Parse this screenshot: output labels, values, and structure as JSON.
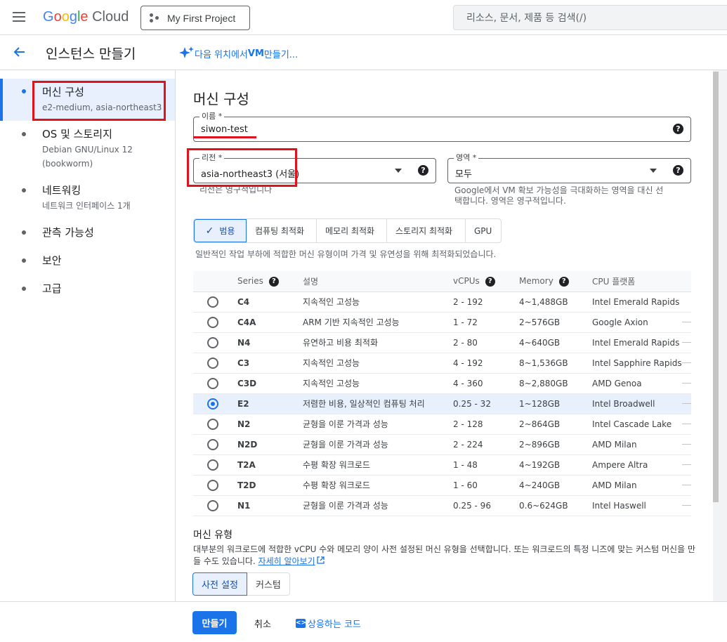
{
  "topbar": {
    "logo_google": "Google",
    "logo_cloud": "Cloud",
    "project": "My First Project",
    "search_placeholder": "리소스, 문서, 제품 등 검색(/)"
  },
  "subheader": {
    "title": "인스턴스 만들기",
    "ai_link_prefix": "다음 위치에서 ",
    "ai_link_bold": "VM",
    "ai_link_suffix": " 만들기..."
  },
  "nav": {
    "items": [
      {
        "label": "머신 구성",
        "sub": "e2-medium, asia-northeast3"
      },
      {
        "label": "OS 및 스토리지",
        "sub": "Debian GNU/Linux 12",
        "sub2": "(bookworm)"
      },
      {
        "label": "네트워킹",
        "sub": "네트워크 인터페이스 1개"
      },
      {
        "label": "관측 가능성"
      },
      {
        "label": "보안"
      },
      {
        "label": "고급"
      }
    ]
  },
  "main": {
    "section_title": "머신 구성",
    "name_label": "이름 *",
    "name_value": "siwon-test",
    "region_label": "리전 *",
    "region_value": "asia-northeast3 (서울)",
    "region_hint": "리전은 영구적입니다",
    "zone_label": "영역 *",
    "zone_value": "모두",
    "zone_hint_1": "Google에서 VM 확보 가능성을 극대화하는 영역을 대신 선",
    "zone_hint_2": "택합니다. 영역은 영구적입니다.",
    "tabs": [
      "범용",
      "컴퓨팅 최적화",
      "메모리 최적화",
      "스토리지 최적화",
      "GPU"
    ],
    "tab_desc": "일반적인 작업 부하에 적합한 머신 유형이며 가격 및 유연성을 위해 최적화되었습니다.",
    "columns": [
      "Series",
      "설명",
      "vCPUs",
      "Memory",
      "CPU 플랫폼"
    ],
    "rows": [
      {
        "series": "C4",
        "desc": "지속적인 고성능",
        "vcpus": "2 - 192",
        "memory": "4~1,488GB",
        "cpu": "Intel Emerald Rapids"
      },
      {
        "series": "C4A",
        "desc": "ARM 기반 지속적인 고성능",
        "vcpus": "1 - 72",
        "memory": "2~576GB",
        "cpu": "Google Axion"
      },
      {
        "series": "N4",
        "desc": "유연하고 비용 최적화",
        "vcpus": "2 - 80",
        "memory": "4~640GB",
        "cpu": "Intel Emerald Rapids"
      },
      {
        "series": "C3",
        "desc": "지속적인 고성능",
        "vcpus": "4 - 192",
        "memory": "8~1,536GB",
        "cpu": "Intel Sapphire Rapids"
      },
      {
        "series": "C3D",
        "desc": "지속적인 고성능",
        "vcpus": "4 - 360",
        "memory": "8~2,880GB",
        "cpu": "AMD Genoa"
      },
      {
        "series": "E2",
        "desc": "저렴한 비용, 일상적인 컴퓨팅 처리",
        "vcpus": "0.25 - 32",
        "memory": "1~128GB",
        "cpu": "Intel Broadwell"
      },
      {
        "series": "N2",
        "desc": "균형을 이룬 가격과 성능",
        "vcpus": "2 - 128",
        "memory": "2~864GB",
        "cpu": "Intel Cascade Lake"
      },
      {
        "series": "N2D",
        "desc": "균형을 이룬 가격과 성능",
        "vcpus": "2 - 224",
        "memory": "2~896GB",
        "cpu": "AMD Milan"
      },
      {
        "series": "T2A",
        "desc": "수평 확장 워크로드",
        "vcpus": "1 - 48",
        "memory": "4~192GB",
        "cpu": "Ampere Altra"
      },
      {
        "series": "T2D",
        "desc": "수평 확장 워크로드",
        "vcpus": "1 - 60",
        "memory": "4~240GB",
        "cpu": "AMD Milan"
      },
      {
        "series": "N1",
        "desc": "균형을 이룬 가격과 성능",
        "vcpus": "0.25 - 96",
        "memory": "0.6~624GB",
        "cpu": "Intel Haswell"
      }
    ],
    "selected_series": "E2",
    "machine_type_title": "머신 유형",
    "machine_type_desc": "대부분의 워크로드에 적합한 vCPU 수와 메모리 양이 사전 설정된 머신 유형을 선택합니다. 또는 워크로드의 특정 니즈에 맞는 커스텀 머신을 만들 수도 있습니다. ",
    "learn_more": "자세히 알아보기",
    "preset_btn": "사전 설정",
    "custom_btn": "커스텀"
  },
  "footer": {
    "create": "만들기",
    "cancel": "취소",
    "equivalent_code": "상응하는 코드"
  },
  "colors": {
    "accent": "#1a73e8",
    "annotation_red": "#e0121b"
  }
}
